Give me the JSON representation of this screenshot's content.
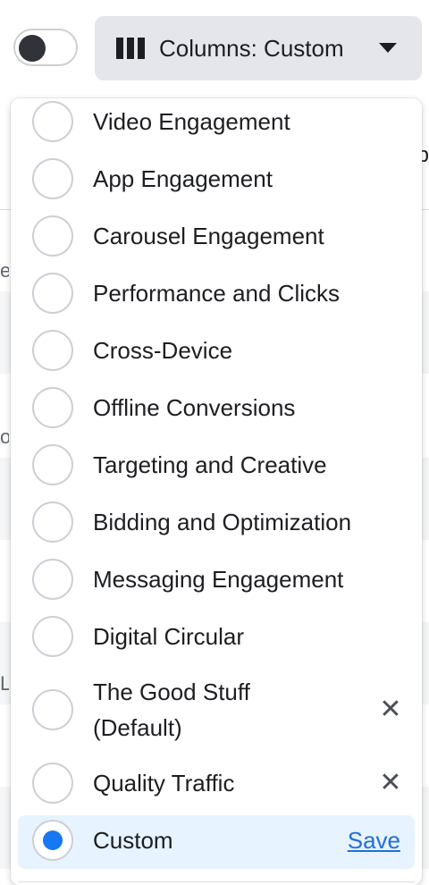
{
  "toolbar": {
    "toggle_on": false,
    "columns_button_label": "Columns: Custom",
    "columns_icon": "columns-icon",
    "caret_icon": "caret-down-icon"
  },
  "background": {
    "left_fragments": [
      "e",
      "o",
      "Li"
    ],
    "right_fragment": "ip"
  },
  "dropdown": {
    "options": [
      {
        "label": "Video Engagement"
      },
      {
        "label": "App Engagement"
      },
      {
        "label": "Carousel Engagement"
      },
      {
        "label": "Performance and Clicks"
      },
      {
        "label": "Cross-Device"
      },
      {
        "label": "Offline Conversions"
      },
      {
        "label": "Targeting and Creative"
      },
      {
        "label": "Bidding and Optimization"
      },
      {
        "label": "Messaging Engagement"
      },
      {
        "label": "Digital Circular"
      },
      {
        "label": "The Good Stuff (Default)",
        "label_line1": "The Good Stuff",
        "label_line2": "(Default)",
        "removable": true
      },
      {
        "label": "Quality Traffic",
        "removable": true
      },
      {
        "label": "Custom",
        "selected": true,
        "action": "Save"
      }
    ],
    "remove_icon": "close-icon",
    "selected_color": "#1877f2",
    "link_color": "#216fdb"
  }
}
